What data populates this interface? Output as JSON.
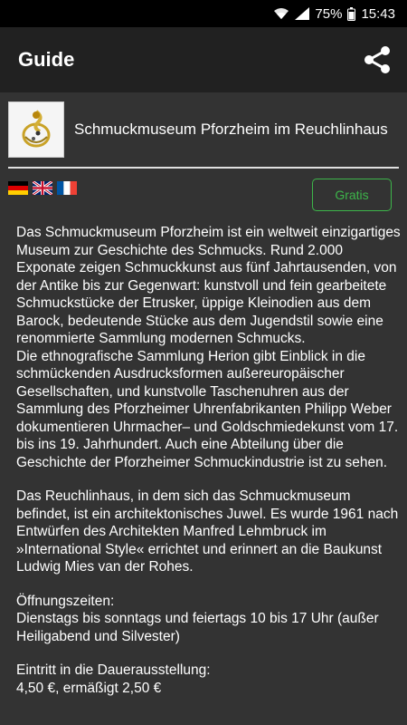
{
  "status_bar": {
    "battery_percent": "75%",
    "time": "15:43",
    "icons": [
      "wifi-icon",
      "signal-icon",
      "battery-icon"
    ]
  },
  "app_bar": {
    "title": "Guide",
    "share_icon": "share-icon"
  },
  "museum": {
    "name": "Schmuckmuseum Pforzheim im Reuchlinhaus",
    "thumbnail_icon": "jewelry-ring-thumbnail"
  },
  "languages": [
    {
      "name": "german-flag-icon"
    },
    {
      "name": "uk-flag-icon"
    },
    {
      "name": "french-flag-icon"
    }
  ],
  "price_button": {
    "label": "Gratis",
    "color": "#3db54a"
  },
  "description": [
    "Das Schmuckmuseum Pforzheim ist ein weltweit einzigartiges Museum zur Geschichte des Schmucks. Rund 2.000 Exponate zeigen Schmuckkunst aus fünf Jahrtausenden, von der Antike bis zur Gegenwart: kunstvoll und fein gearbeitete Schmuckstücke der Etrusker, üppige Kleinodien aus dem Barock, bedeutende Stücke aus dem Jugendstil sowie eine renommierte Sammlung modernen Schmucks.",
    "Die ethnografische Sammlung Herion gibt Einblick in die schmückenden Ausdrucksformen außereuropäischer Gesellschaften, und kunstvolle Taschenuhren aus der Sammlung des Pforzheimer Uhrenfabrikanten Philipp Weber dokumentieren Uhrmacher– und Goldschmiedekunst vom 17. bis ins 19. Jahrhundert. Auch eine Abteilung über die Geschichte der Pforzheimer Schmuckindustrie ist zu sehen.",
    "Das Reuchlinhaus, in dem sich das Schmuckmuseum befindet, ist ein architektonisches Juwel. Es wurde 1961 nach Entwürfen des Architekten Manfred Lehmbruck im »International Style« errichtet und erinnert an die Baukunst Ludwig Mies van der Rohes.",
    "Öffnungszeiten:",
    "Dienstags bis sonntags und feiertags 10 bis 17 Uhr (außer Heiligabend und Silvester)",
    "Eintritt in die Dauerausstellung:",
    "4,50 €, ermäßigt 2,50 €"
  ]
}
